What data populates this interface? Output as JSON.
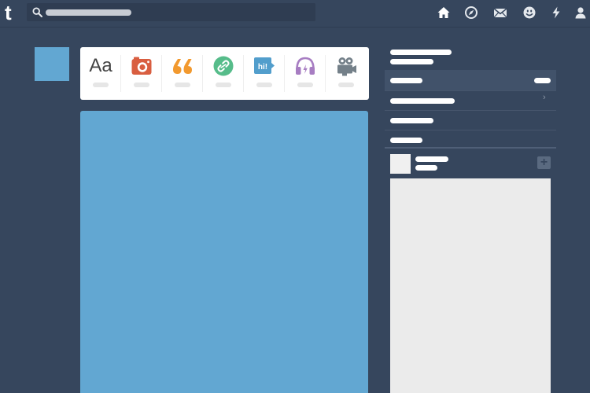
{
  "app": {
    "logo_text": "t"
  },
  "search": {
    "placeholder": ""
  },
  "nav": {
    "items": [
      {
        "icon": "home-icon"
      },
      {
        "icon": "compass-icon"
      },
      {
        "icon": "mail-icon"
      },
      {
        "icon": "smiley-icon"
      },
      {
        "icon": "lightning-icon"
      },
      {
        "icon": "user-icon"
      }
    ]
  },
  "post_types": [
    {
      "icon": "text-icon",
      "glyph": "Aa",
      "color": "#444444"
    },
    {
      "icon": "camera-icon",
      "color": "#d95e40"
    },
    {
      "icon": "quote-icon",
      "color": "#f2992e"
    },
    {
      "icon": "link-icon",
      "color": "#56bc8a"
    },
    {
      "icon": "chat-icon",
      "glyph": "hi!",
      "color": "#529ecc"
    },
    {
      "icon": "headphones-icon",
      "color": "#a77dc2"
    },
    {
      "icon": "video-camera-icon",
      "color": "#748089"
    }
  ],
  "colors": {
    "background": "#36465d",
    "avatar": "#62a7d2",
    "post": "#62a7d2",
    "panel": "#ebebeb"
  },
  "recommended": {
    "follow_glyph": "+"
  }
}
